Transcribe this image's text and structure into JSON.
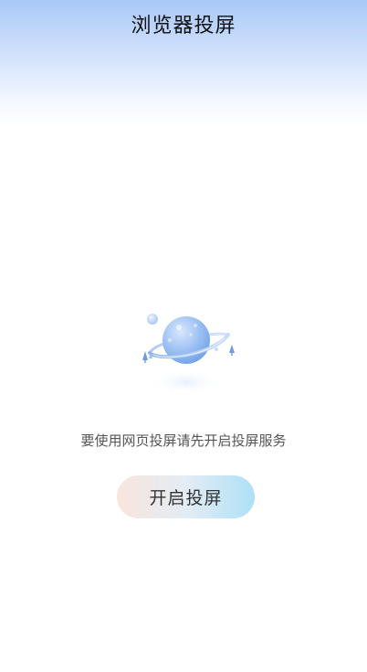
{
  "header": {
    "title": "浏览器投屏"
  },
  "empty_state": {
    "illustration_icon": "planet-icon",
    "message": "要使用网页投屏请先开启投屏服务",
    "button_label": "开启投屏"
  },
  "colors": {
    "header_gradient_top": "#a9c8f8",
    "planet": "#93b9f0",
    "button_gradient_start": "#f9e5dd",
    "button_gradient_end": "#aee0f6"
  }
}
